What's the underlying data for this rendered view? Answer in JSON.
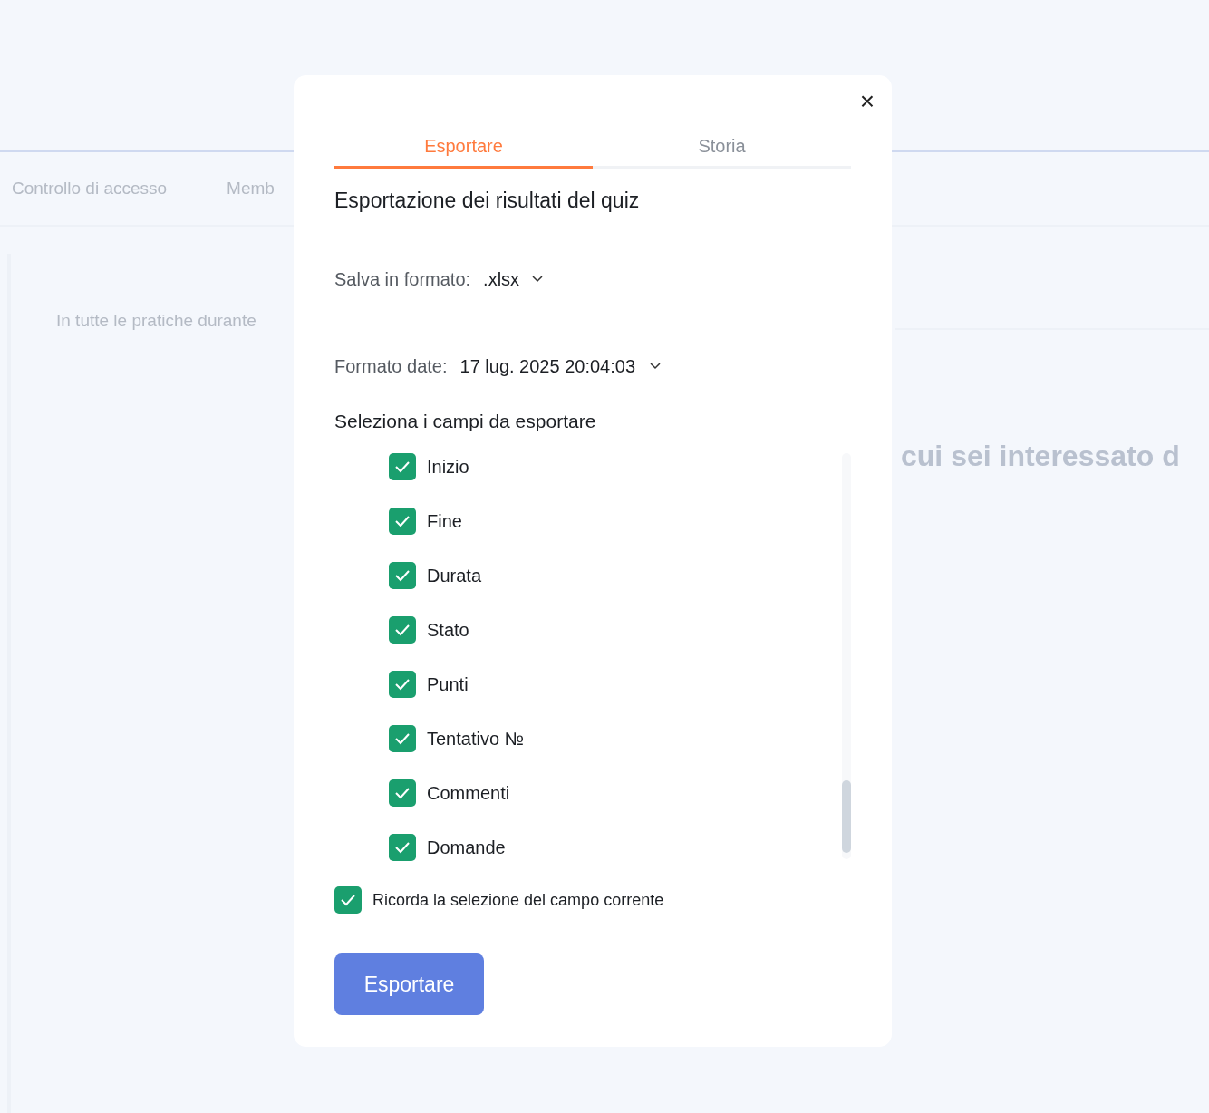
{
  "background": {
    "tabs": [
      "Controllo di accesso",
      "Memb"
    ],
    "text_fragment": "In tutte le pratiche durante",
    "heading_fragment": "cui sei interessato d"
  },
  "dialog": {
    "close": "×",
    "tabs": [
      {
        "label": "Esportare",
        "selected": true
      },
      {
        "label": "Storia",
        "selected": false
      }
    ],
    "title": "Esportazione dei risultati del quiz",
    "save_format": {
      "label": "Salva in formato:",
      "value": ".xlsx"
    },
    "date_format": {
      "label": "Formato date:",
      "value": "17 lug. 2025 20:04:03"
    },
    "fields_heading": "Seleziona i campi da esportare",
    "fields": [
      {
        "label": "Inizio",
        "checked": true
      },
      {
        "label": "Fine",
        "checked": true
      },
      {
        "label": "Durata",
        "checked": true
      },
      {
        "label": "Stato",
        "checked": true
      },
      {
        "label": "Punti",
        "checked": true
      },
      {
        "label": "Tentativo №",
        "checked": true
      },
      {
        "label": "Commenti",
        "checked": true
      },
      {
        "label": "Domande",
        "checked": true
      }
    ],
    "remember": {
      "label": "Ricorda la selezione del campo corrente",
      "checked": true
    },
    "export_button": "Esportare"
  }
}
